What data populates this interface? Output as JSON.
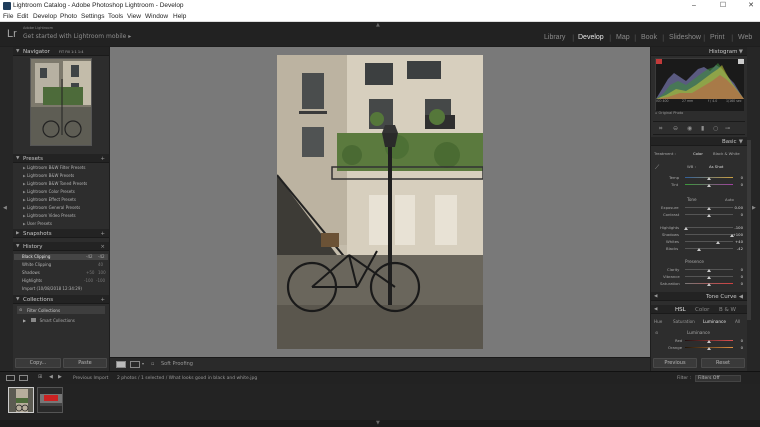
{
  "window": {
    "title": "Lightroom Catalog - Adobe Photoshop Lightroom - Develop",
    "minimize": "–",
    "maximize": "☐",
    "close": "✕"
  },
  "menu": [
    "File",
    "Edit",
    "Develop",
    "Photo",
    "Settings",
    "Tools",
    "View",
    "Window",
    "Help"
  ],
  "identity": {
    "logo": "Lr",
    "small": "Adobe Lightroom",
    "main": "Get started with Lightroom mobile  ▸"
  },
  "modules": [
    "Library",
    "Develop",
    "Map",
    "Book",
    "Slideshow",
    "Print",
    "Web"
  ],
  "active_module": "Develop",
  "left": {
    "navigator": {
      "label": "Navigator",
      "opts": "FIT   Fill   1:1   1:4"
    },
    "presets": {
      "label": "Presets",
      "items": [
        "Lightroom B&W Filter Presets",
        "Lightroom B&W Presets",
        "Lightroom B&W Toned Presets",
        "Lightroom Color Presets",
        "Lightroom Effect Presets",
        "Lightroom General Presets",
        "Lightroom Video Presets",
        "User Presets"
      ]
    },
    "snapshots": {
      "label": "Snapshots"
    },
    "history": {
      "label": "History",
      "items": [
        {
          "name": "Black Clipping",
          "a": "-42",
          "b": "-42"
        },
        {
          "name": "White Clipping",
          "a": "",
          "b": "40"
        },
        {
          "name": "Shadows",
          "a": "+50",
          "b": "100"
        },
        {
          "name": "Highlights",
          "a": "-100",
          "b": "-100"
        },
        {
          "name": "Import (10/08/2018 12:34:29)",
          "a": "",
          "b": ""
        }
      ]
    },
    "collections": {
      "label": "Collections",
      "items": [
        "Filter Collections",
        "Smart Collections"
      ]
    },
    "copy": "Copy...",
    "paste": "Paste"
  },
  "toolbar": {
    "soft_proofing": "Soft Proofing"
  },
  "filmstrip": {
    "prev_import": "Previous Import",
    "info": "2 photos / 1 selected / What looks good in black and white.jpg",
    "filter_label": "Filter :",
    "filter_value": "Filters Off"
  },
  "right": {
    "histogram": {
      "label": "Histogram",
      "iso": "ISO 400",
      "focal": "27 mm",
      "aperture": "f / 4.0",
      "shutter": "1/160 sec",
      "original": "Original Photo"
    },
    "basic": {
      "label": "Basic",
      "treatment": "Treatment :",
      "color": "Color",
      "bw": "Black & White",
      "wb": "WB :",
      "as_shot": "As Shot",
      "temp": "Temp",
      "tint": "Tint",
      "tone": "Tone",
      "auto": "Auto",
      "exposure": {
        "name": "Exposure",
        "value": "0.00"
      },
      "contrast": {
        "name": "Contrast",
        "value": "0"
      },
      "highlights": {
        "name": "Highlights",
        "value": "-100"
      },
      "shadows": {
        "name": "Shadows",
        "value": "+100"
      },
      "whites": {
        "name": "Whites",
        "value": "+40"
      },
      "blacks": {
        "name": "Blacks",
        "value": "-42"
      },
      "presence": "Presence",
      "clarity": {
        "name": "Clarity",
        "value": "0"
      },
      "vibrance": {
        "name": "Vibrance",
        "value": "0"
      },
      "saturation": {
        "name": "Saturation",
        "value": "0"
      },
      "temp_value": "0",
      "tint_value": "0"
    },
    "tone_curve": {
      "label": "Tone Curve"
    },
    "hsl": {
      "label_hsl": "HSL",
      "label_color": "Color",
      "label_bw": "B & W",
      "tabs": [
        "Hue",
        "Saturation",
        "Luminance",
        "All"
      ],
      "active_tab": "Luminance",
      "section": "Luminance",
      "red": {
        "name": "Red",
        "value": "0"
      },
      "orange": {
        "name": "Orange",
        "value": "0"
      }
    },
    "previous": "Previous",
    "reset": "Reset"
  }
}
